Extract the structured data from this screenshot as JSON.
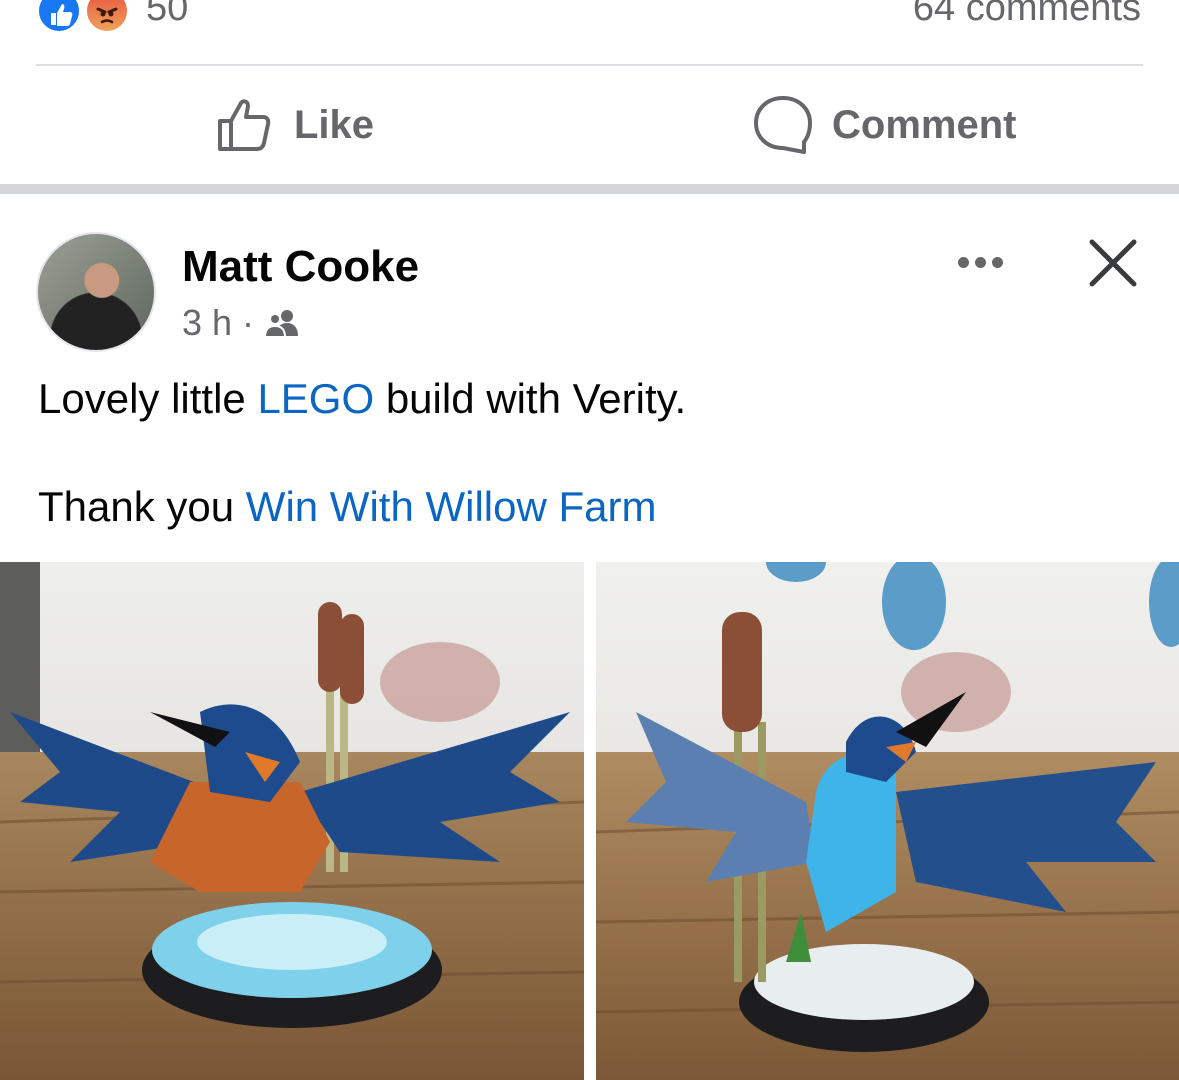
{
  "reactions": {
    "count": "50",
    "comments_label": "64 comments",
    "icons": [
      "like-reaction-icon",
      "angry-reaction-icon"
    ],
    "colors": {
      "like": "#1877f2",
      "angry": "#e8533f"
    }
  },
  "actions": {
    "like_label": "Like",
    "comment_label": "Comment"
  },
  "post": {
    "author": "Matt Cooke",
    "time": "3 h",
    "separator": "·",
    "audience_icon": "friends-icon",
    "text_line1_before": "Lovely little ",
    "text_line1_link": "LEGO",
    "text_line1_after": " build with Verity.",
    "text_line2_before": "Thank you ",
    "text_line2_link": "Win With Willow Farm",
    "link_color": "#0a66c2",
    "photos": [
      {
        "alt": "LEGO kingfisher build, front view"
      },
      {
        "alt": "LEGO kingfisher build, side view"
      }
    ]
  }
}
